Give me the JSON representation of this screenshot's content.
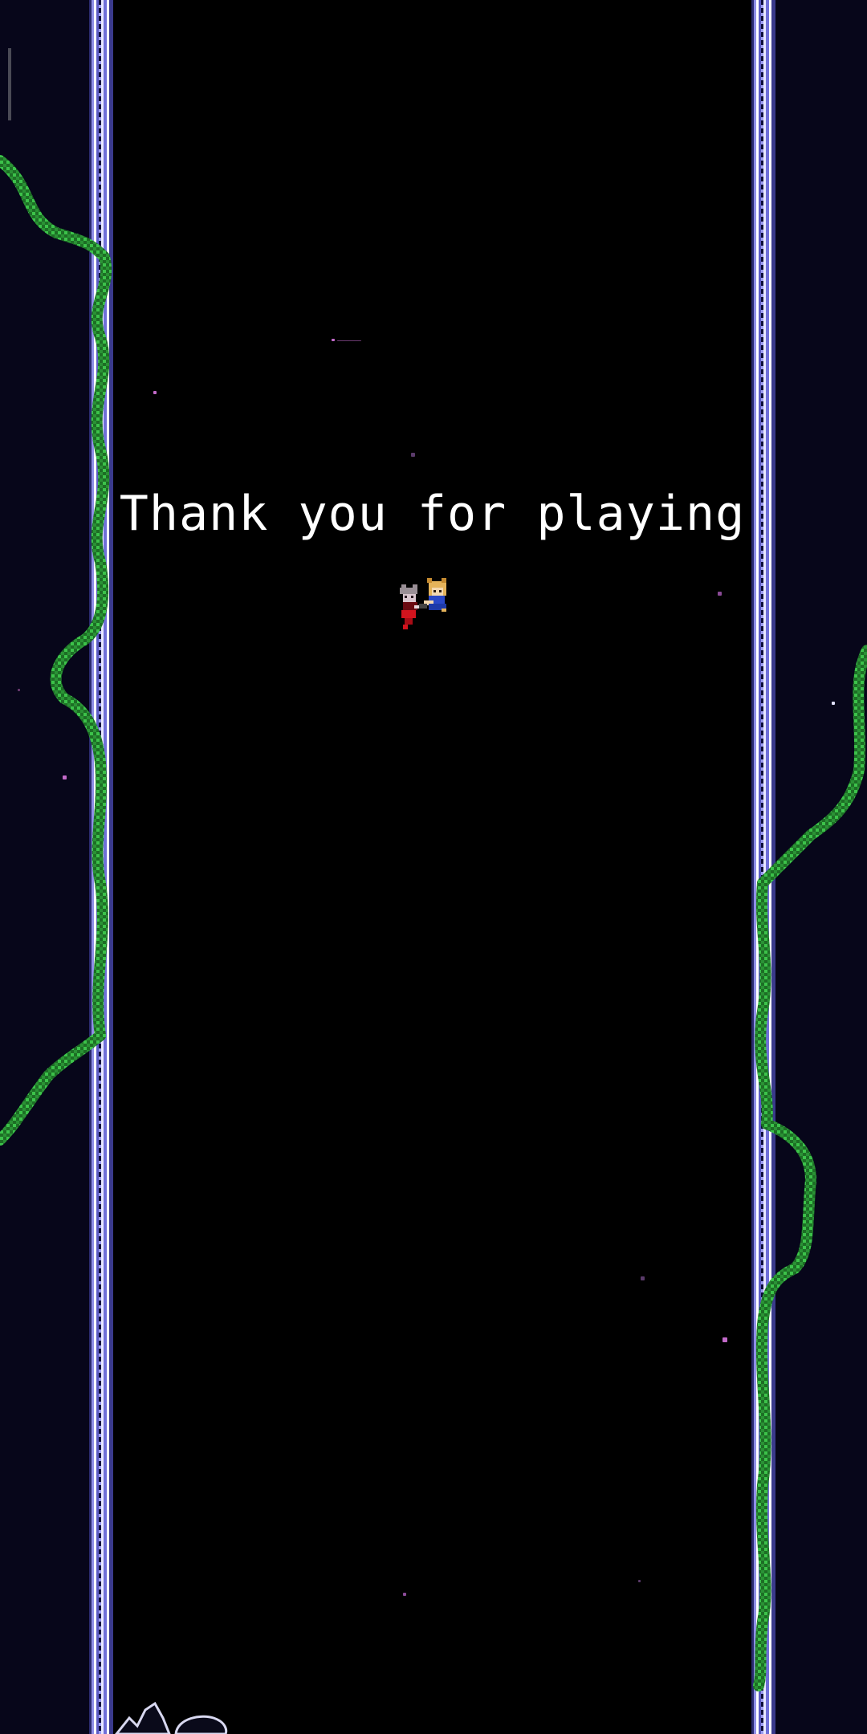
{
  "screen": {
    "message": "Thank you for playing"
  },
  "characters": [
    {
      "name": "red-dress-girl-sprite"
    },
    {
      "name": "blue-dress-girl-sprite"
    }
  ],
  "colors": {
    "vine": "#2fae3a",
    "vine_dark": "#1d6e25",
    "text": "#ffffff",
    "sparkle": "#c26ac9"
  }
}
